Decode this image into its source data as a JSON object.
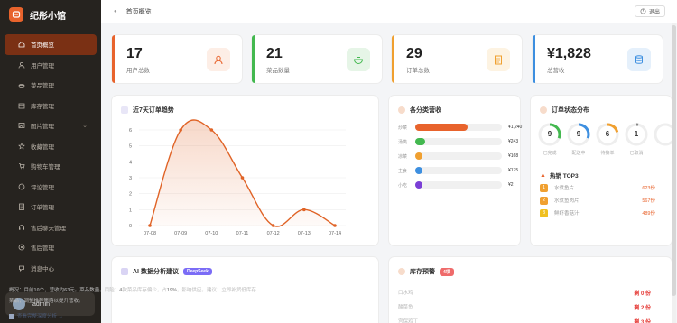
{
  "app": {
    "name": "纪彤小馆",
    "breadcrumb": "首页概览",
    "logout": "退出"
  },
  "sidebar": {
    "items": [
      {
        "label": "首页概览",
        "icon": "home-icon",
        "active": true
      },
      {
        "label": "用户管理",
        "icon": "user-icon"
      },
      {
        "label": "菜品管理",
        "icon": "dish-icon"
      },
      {
        "label": "库存管理",
        "icon": "inventory-icon"
      },
      {
        "label": "图片管理",
        "icon": "image-icon",
        "has_chevron": true
      },
      {
        "label": "收藏管理",
        "icon": "star-icon"
      },
      {
        "label": "购物车管理",
        "icon": "cart-icon"
      },
      {
        "label": "评论管理",
        "icon": "comment-icon"
      },
      {
        "label": "订单管理",
        "icon": "order-icon"
      },
      {
        "label": "售后聊天管理",
        "icon": "headset-icon"
      },
      {
        "label": "售后管理",
        "icon": "service-icon"
      },
      {
        "label": "消息中心",
        "icon": "message-icon"
      }
    ],
    "user": {
      "name": "admin"
    }
  },
  "stats": [
    {
      "value": "17",
      "label": "用户总数",
      "color": "#e8632c",
      "icon": "user-icon"
    },
    {
      "value": "21",
      "label": "菜品数量",
      "color": "#43b84f",
      "icon": "bowl-icon"
    },
    {
      "value": "29",
      "label": "订单总数",
      "color": "#f0a030",
      "icon": "clipboard-icon"
    },
    {
      "value": "¥1,828",
      "label": "总营收",
      "color": "#3d8fe0",
      "icon": "database-icon"
    }
  ],
  "trend": {
    "title": "近7天订单趋势",
    "chart_data": {
      "type": "area",
      "title": "近7天订单趋势",
      "x": [
        "07-08",
        "07-09",
        "07-10",
        "07-11",
        "07-12",
        "07-13",
        "07-14"
      ],
      "y": [
        0,
        6,
        6,
        3,
        0,
        1,
        0
      ],
      "y_ticks": [
        "0",
        "1",
        "2",
        "3",
        "4",
        "5",
        "6"
      ],
      "ylim": [
        0,
        6
      ],
      "grid": true,
      "color": "#e06326"
    }
  },
  "category_revenue": {
    "title": "各分类营收",
    "chart_data": {
      "type": "bar",
      "orientation": "horizontal",
      "categories": [
        "炒菜",
        "汤类",
        "凉菜",
        "主食",
        "小吃"
      ],
      "values": [
        1240,
        243,
        168,
        175,
        2
      ],
      "value_labels": [
        "¥1,240",
        "¥243",
        "¥168",
        "¥175",
        "¥2"
      ],
      "colors": [
        "#e8632c",
        "#43b84f",
        "#f0a030",
        "#3d8fe0",
        "#7b3fd6"
      ]
    }
  },
  "order_status": {
    "title": "订单状态分布",
    "rings": [
      {
        "value": "9",
        "label": "已完成",
        "fraction": 0.31,
        "color": "#43b84f"
      },
      {
        "value": "9",
        "label": "配送中",
        "fraction": 0.31,
        "color": "#3d8fe0"
      },
      {
        "value": "6",
        "label": "待接单",
        "fraction": 0.21,
        "color": "#f0a030"
      },
      {
        "value": "1",
        "label": "已取消",
        "fraction": 0.03,
        "color": "#888888"
      }
    ]
  },
  "top3": {
    "title": "热销 TOP3",
    "items": [
      {
        "rank": "1",
        "name": "水煮鱼片",
        "value": "623份",
        "color": "#f0a030"
      },
      {
        "rank": "2",
        "name": "水煮鱼肉片",
        "value": "567份",
        "color": "#f0a030"
      },
      {
        "rank": "3",
        "name": "鲜虾香菇汁",
        "value": "489份",
        "color": "#f0c020"
      }
    ]
  },
  "ai": {
    "title": "AI 数据分析建议",
    "badge": "DeepSeek",
    "text_prefix": "概况：目前",
    "text_1": "10",
    "text_mid1": "个，营收约",
    "text_2": "63",
    "text_mid2": "元。菜品数量。风险：",
    "text_3": "4",
    "text_mid3": "款菜品库存偏少，占",
    "text_4": "19%",
    "text_suffix": "，影响供应。建议：立即补货低库存菜品，调整推荐策略以提升营收。",
    "link": "查看完整深度分析 →"
  },
  "stock": {
    "title": "库存预警",
    "badge": "4项",
    "items": [
      {
        "name": "口水鸡",
        "value": "剩 0 份"
      },
      {
        "name": "酸菜鱼",
        "value": "剩 2 份"
      },
      {
        "name": "宫保鸡丁",
        "value": "剩 3 份"
      }
    ]
  }
}
